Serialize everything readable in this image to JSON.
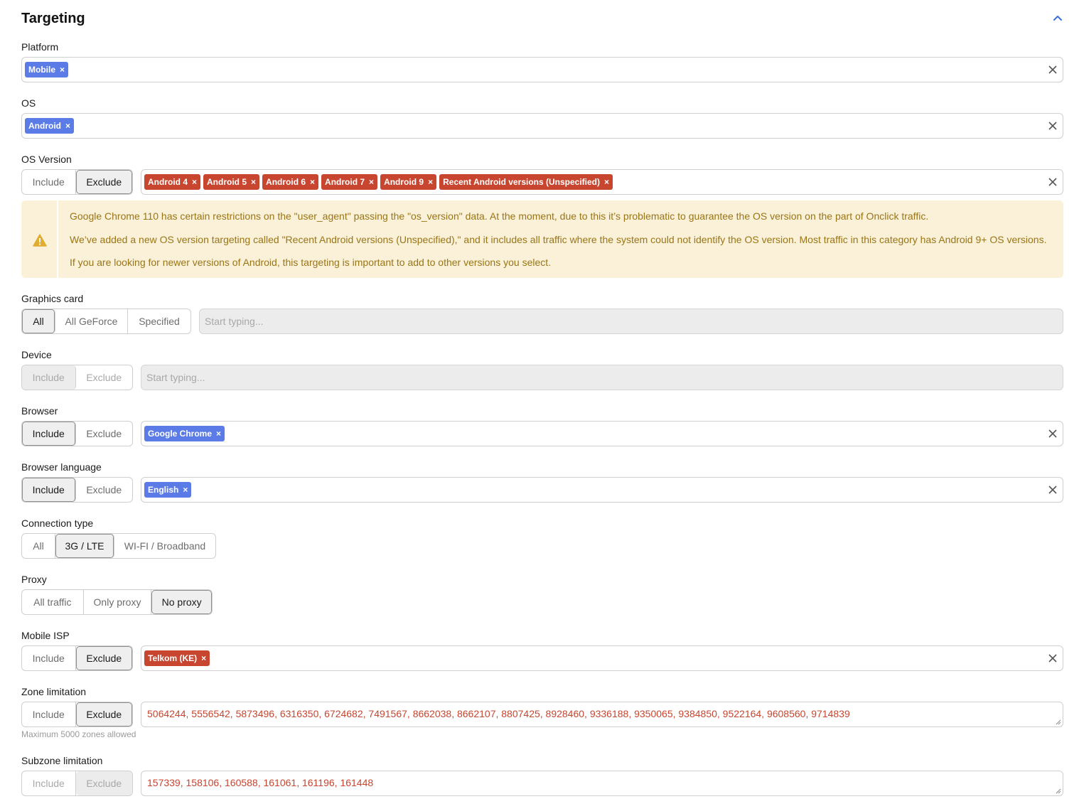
{
  "title": "Targeting",
  "platform": {
    "label": "Platform",
    "chips": [
      "Mobile"
    ]
  },
  "os": {
    "label": "OS",
    "chips": [
      "Android"
    ]
  },
  "os_version": {
    "label": "OS Version",
    "toggle": [
      "Include",
      "Exclude"
    ],
    "selected": "Exclude",
    "chips": [
      "Android 4",
      "Android 5",
      "Android 6",
      "Android 7",
      "Android 9",
      "Recent Android versions (Unspecified)"
    ]
  },
  "alert": {
    "lines": [
      "Google Chrome 110 has certain restrictions on the \"user_agent\" passing the \"os_version\" data. At the moment, due to this it’s problematic to guarantee the OS version on the part of Onclick traffic.",
      "We’ve added a new OS version targeting called \"Recent Android versions (Unspecified),\" and it includes all traffic where the system could not identify the OS version. Most traffic in this category has Android 9+ OS versions.",
      "If you are looking for newer versions of Android, this targeting is important to add to other versions you select."
    ]
  },
  "graphics_card": {
    "label": "Graphics card",
    "options": [
      "All",
      "All GeForce",
      "Specified"
    ],
    "selected": "All",
    "placeholder": "Start typing..."
  },
  "device": {
    "label": "Device",
    "toggle": [
      "Include",
      "Exclude"
    ],
    "selected": "Include",
    "placeholder": "Start typing..."
  },
  "browser": {
    "label": "Browser",
    "toggle": [
      "Include",
      "Exclude"
    ],
    "selected": "Include",
    "chips": [
      "Google Chrome"
    ]
  },
  "browser_language": {
    "label": "Browser language",
    "toggle": [
      "Include",
      "Exclude"
    ],
    "selected": "Include",
    "chips": [
      "English"
    ]
  },
  "connection_type": {
    "label": "Connection type",
    "options": [
      "All",
      "3G / LTE",
      "WI-FI / Broadband"
    ],
    "selected": "3G / LTE"
  },
  "proxy": {
    "label": "Proxy",
    "options": [
      "All traffic",
      "Only proxy",
      "No proxy"
    ],
    "selected": "No proxy"
  },
  "mobile_isp": {
    "label": "Mobile ISP",
    "toggle": [
      "Include",
      "Exclude"
    ],
    "selected": "Exclude",
    "chips": [
      "Telkom (KE)"
    ]
  },
  "zone_limitation": {
    "label": "Zone limitation",
    "toggle": [
      "Include",
      "Exclude"
    ],
    "selected": "Exclude",
    "value": "5064244, 5556542, 5873496, 6316350, 6724682, 7491567, 8662038, 8662107, 8807425, 8928460, 9336188, 9350065, 9384850, 9522164, 9608560, 9714839",
    "hint": "Maximum 5000 zones allowed"
  },
  "subzone_limitation": {
    "label": "Subzone limitation",
    "toggle": [
      "Include",
      "Exclude"
    ],
    "selected": "Exclude",
    "value": "157339, 158106, 160588, 161061, 161196, 161448"
  },
  "colors": {
    "chip_blue": "#5b7be6",
    "chip_red": "#c8452f",
    "alert_bg": "#fbf1d8",
    "alert_text": "#9a7516",
    "accent": "#3b6fe0"
  }
}
